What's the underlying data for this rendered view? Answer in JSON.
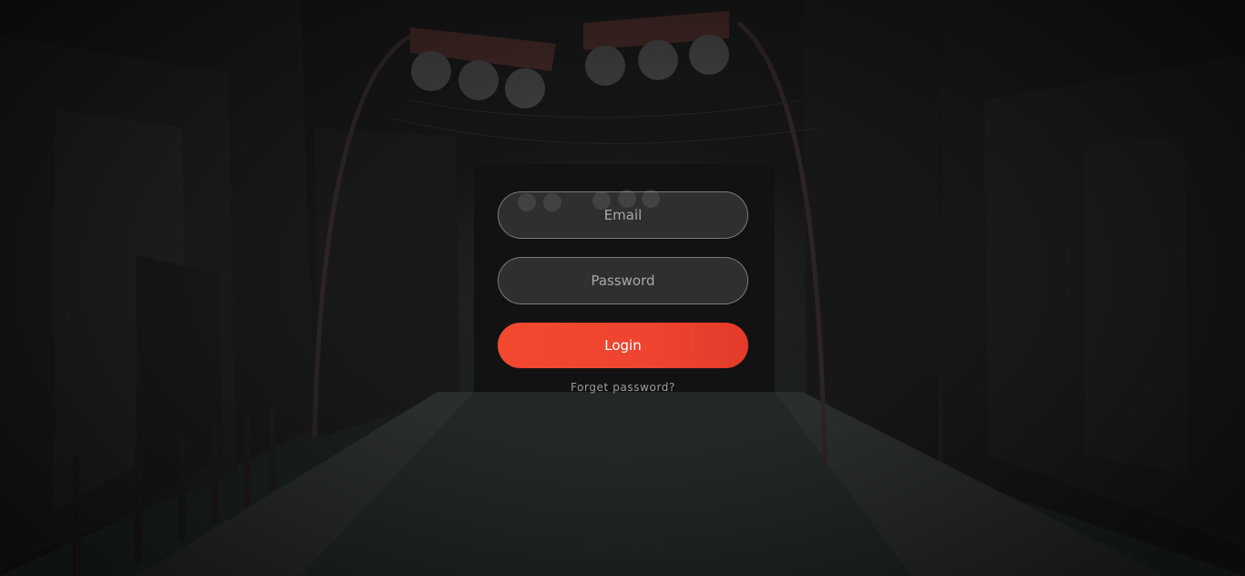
{
  "login": {
    "email_placeholder": "Email",
    "password_placeholder": "Password",
    "login_label": "Login",
    "forgot_label": "Forget password?"
  },
  "colors": {
    "accent": "#f3492f",
    "field_border": "#bebebe",
    "background": "#141414"
  }
}
